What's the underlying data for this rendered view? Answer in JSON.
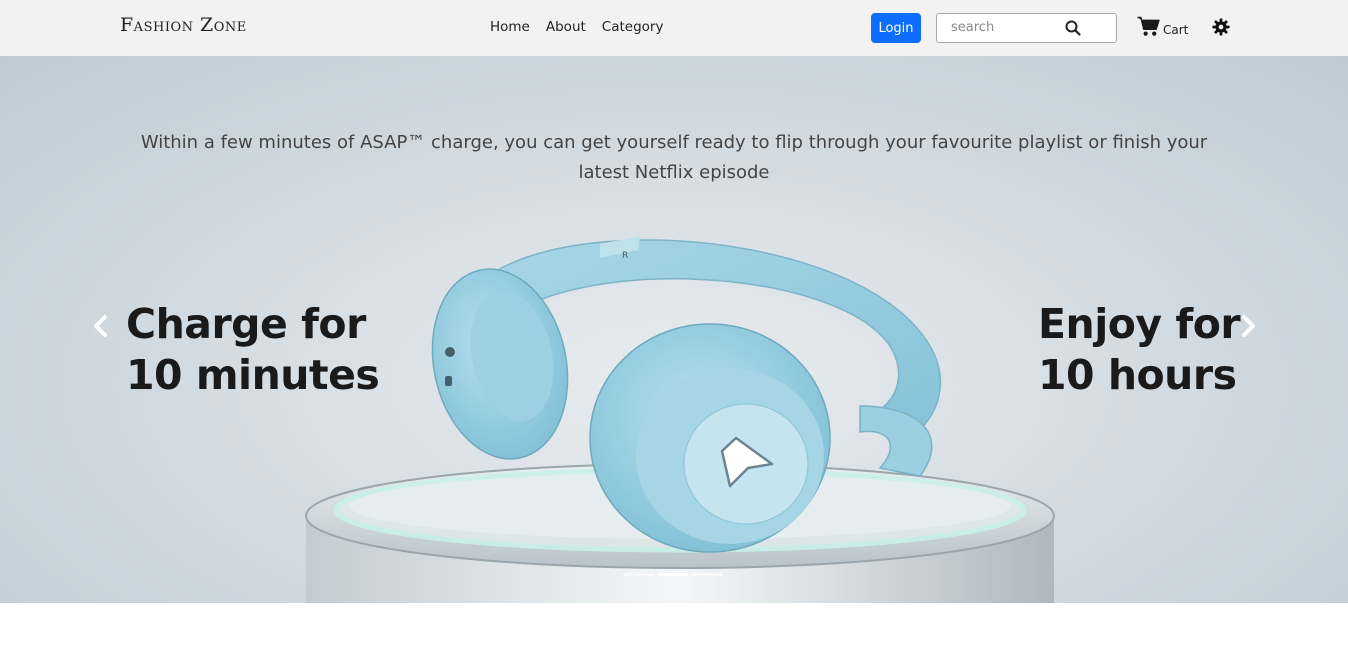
{
  "brand": "Fashion Zone",
  "nav": {
    "links": [
      "Home",
      "About",
      "Category"
    ]
  },
  "actions": {
    "login_label": "Login",
    "search_placeholder": "search",
    "cart_label": "Cart",
    "icons": [
      "search-icon",
      "cart-icon",
      "gear-icon"
    ]
  },
  "hero": {
    "tagline": "Within a few minutes of ASAP™ charge, you can get yourself ready to flip through your favourite playlist or finish your latest Netflix episode",
    "left_line1": "Charge for",
    "left_line2": "10 minutes",
    "right_line1": "Enjoy for",
    "right_line2": "10 hours",
    "prev_icon": "chevron-left-icon",
    "next_icon": "chevron-right-icon",
    "slides": 3,
    "active_slide": 2
  },
  "colors": {
    "primary": "#0d6efd",
    "navbar_bg": "#f2f2f2",
    "headphone": "#9ccfe0"
  }
}
